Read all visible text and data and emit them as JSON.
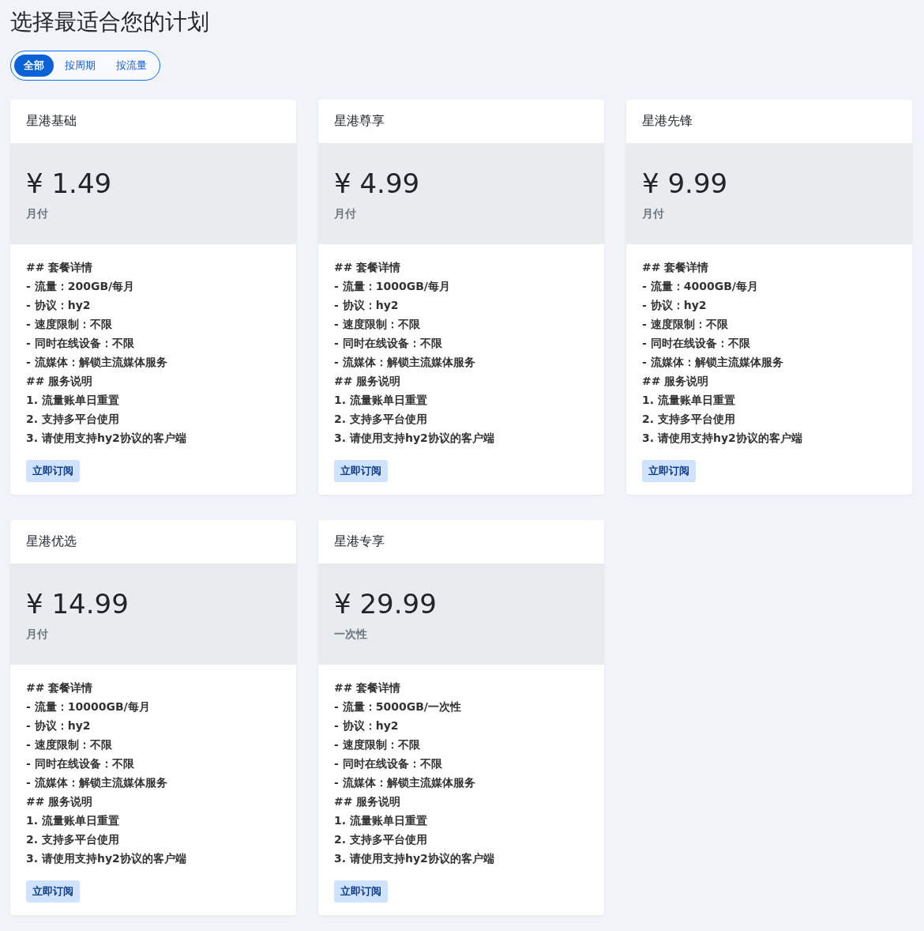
{
  "title": "选择最适合您的计划",
  "tabs": [
    {
      "label": "全部",
      "selected": true
    },
    {
      "label": "按周期",
      "selected": false
    },
    {
      "label": "按流量",
      "selected": false
    }
  ],
  "plans": [
    {
      "name": "星港基础",
      "price": "¥ 1.49",
      "period": "月付",
      "details": [
        "## 套餐详情",
        "- 流量：200GB/每月",
        "- 协议：hy2",
        "- 速度限制：不限",
        "- 同时在线设备：不限",
        "- 流媒体：解锁主流媒体服务",
        "## 服务说明",
        "1. 流量账单日重置",
        "2. 支持多平台使用",
        "3. 请使用支持hy2协议的客户端"
      ],
      "button": "立即订阅"
    },
    {
      "name": "星港尊享",
      "price": "¥ 4.99",
      "period": "月付",
      "details": [
        "## 套餐详情",
        "- 流量：1000GB/每月",
        "- 协议：hy2",
        "- 速度限制：不限",
        "- 同时在线设备：不限",
        "- 流媒体：解锁主流媒体服务",
        "## 服务说明",
        "1. 流量账单日重置",
        "2. 支持多平台使用",
        "3. 请使用支持hy2协议的客户端"
      ],
      "button": "立即订阅"
    },
    {
      "name": "星港先锋",
      "price": "¥ 9.99",
      "period": "月付",
      "details": [
        "## 套餐详情",
        "- 流量：4000GB/每月",
        "- 协议：hy2",
        "- 速度限制：不限",
        "- 同时在线设备：不限",
        "- 流媒体：解锁主流媒体服务",
        "## 服务说明",
        "1. 流量账单日重置",
        "2. 支持多平台使用",
        "3. 请使用支持hy2协议的客户端"
      ],
      "button": "立即订阅"
    },
    {
      "name": "星港优选",
      "price": "¥ 14.99",
      "period": "月付",
      "details": [
        "## 套餐详情",
        "- 流量：10000GB/每月",
        "- 协议：hy2",
        "- 速度限制：不限",
        "- 同时在线设备：不限",
        "- 流媒体：解锁主流媒体服务",
        "## 服务说明",
        "1. 流量账单日重置",
        "2. 支持多平台使用",
        "3. 请使用支持hy2协议的客户端"
      ],
      "button": "立即订阅"
    },
    {
      "name": "星港专享",
      "price": "¥ 29.99",
      "period": "一次性",
      "details": [
        "## 套餐详情",
        "- 流量：5000GB/一次性",
        "- 协议：hy2",
        "- 速度限制：不限",
        "- 同时在线设备：不限",
        "- 流媒体：解锁主流媒体服务",
        "## 服务说明",
        "1. 流量账单日重置",
        "2. 支持多平台使用",
        "3. 请使用支持hy2协议的客户端"
      ],
      "button": "立即订阅"
    }
  ]
}
